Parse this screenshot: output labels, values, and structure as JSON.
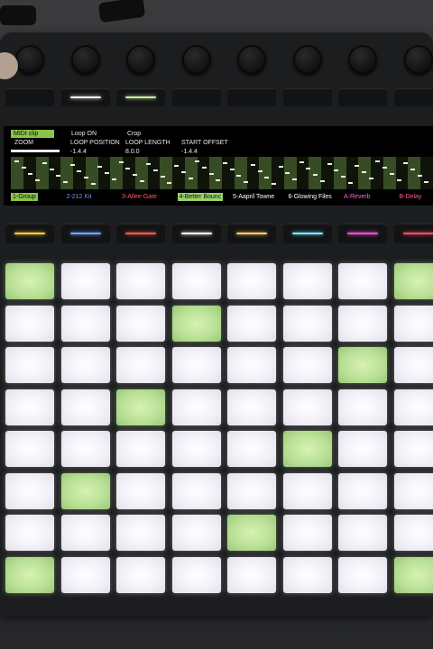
{
  "display": {
    "mode_label": "MIDI clip",
    "zoom_label": "ZOOM",
    "loop_on_label": "Loop ON",
    "crop_label": "Crop",
    "loop_position_label": "LOOP POSITION",
    "loop_position_value": "-1.4.4",
    "loop_length_label": "LOOP LENGTH",
    "loop_length_value": "8.0.0",
    "start_offset_label": "START OFFSET",
    "start_offset_value": "-1.4.4",
    "tracks": [
      {
        "label": "1-Group",
        "color": "#8bc34a",
        "selected": true
      },
      {
        "label": "2-212 Kit",
        "color": "#7d8bff",
        "selected": false
      },
      {
        "label": "3-Allee Gate",
        "color": "#ff5a5a",
        "selected": false
      },
      {
        "label": "4-Better Bounc",
        "color": "#9bd36b",
        "selected": true
      },
      {
        "label": "5-Aapril Towne",
        "color": "#ffffff",
        "selected": false
      },
      {
        "label": "6-Glowing Files",
        "color": "#ffffff",
        "selected": false
      },
      {
        "label": "A-Reverb",
        "color": "#ff66cc",
        "selected": false
      },
      {
        "label": "B-Delay",
        "color": "#ff5a8a",
        "selected": false
      }
    ]
  },
  "upper_buttons": [
    {
      "led": ""
    },
    {
      "led": "#f4f4f4"
    },
    {
      "led": "#c8f0a0"
    },
    {
      "led": ""
    },
    {
      "led": ""
    },
    {
      "led": ""
    },
    {
      "led": ""
    },
    {
      "led": ""
    }
  ],
  "lower_buttons": [
    {
      "led": "#ffcf3a"
    },
    {
      "led": "#6fa8ff"
    },
    {
      "led": "#ff5a4a"
    },
    {
      "led": "#ffffff"
    },
    {
      "led": "#ffcf6a"
    },
    {
      "led": "#7fe8ff"
    },
    {
      "led": "#ff4fd8"
    },
    {
      "led": "#ff4a6a"
    }
  ],
  "pad_grid": {
    "rows": 8,
    "cols": 8,
    "lit": [
      [
        0,
        0
      ],
      [
        0,
        7
      ],
      [
        1,
        3
      ],
      [
        2,
        6
      ],
      [
        3,
        2
      ],
      [
        4,
        5
      ],
      [
        5,
        1
      ],
      [
        6,
        4
      ],
      [
        7,
        0
      ],
      [
        7,
        7
      ]
    ]
  },
  "colors": {
    "pad_white": "#f3f1f8",
    "pad_green": "#b8df95",
    "accent_green": "#8bc34a"
  }
}
